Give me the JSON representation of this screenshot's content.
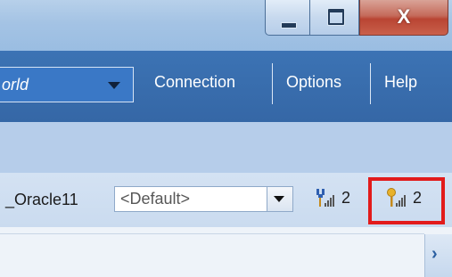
{
  "window": {
    "minimize_icon": "minimize-icon",
    "maximize_icon": "maximize-icon",
    "close_glyph": "X"
  },
  "menubar": {
    "combo_value": "orld",
    "items": [
      "Connection",
      "Options",
      "Help"
    ]
  },
  "toolbar": {
    "profile_label": "_Oracle11",
    "select_value": "<Default>",
    "connections": [
      {
        "icon": "connection-signal-icon",
        "count": "2"
      },
      {
        "icon": "lock-connection-signal-icon",
        "count": "2"
      }
    ]
  },
  "colors": {
    "menubar": "#3c73b4",
    "band": "#b6cdea",
    "toolbar": "#cadbef",
    "highlight": "#e21b1b"
  }
}
